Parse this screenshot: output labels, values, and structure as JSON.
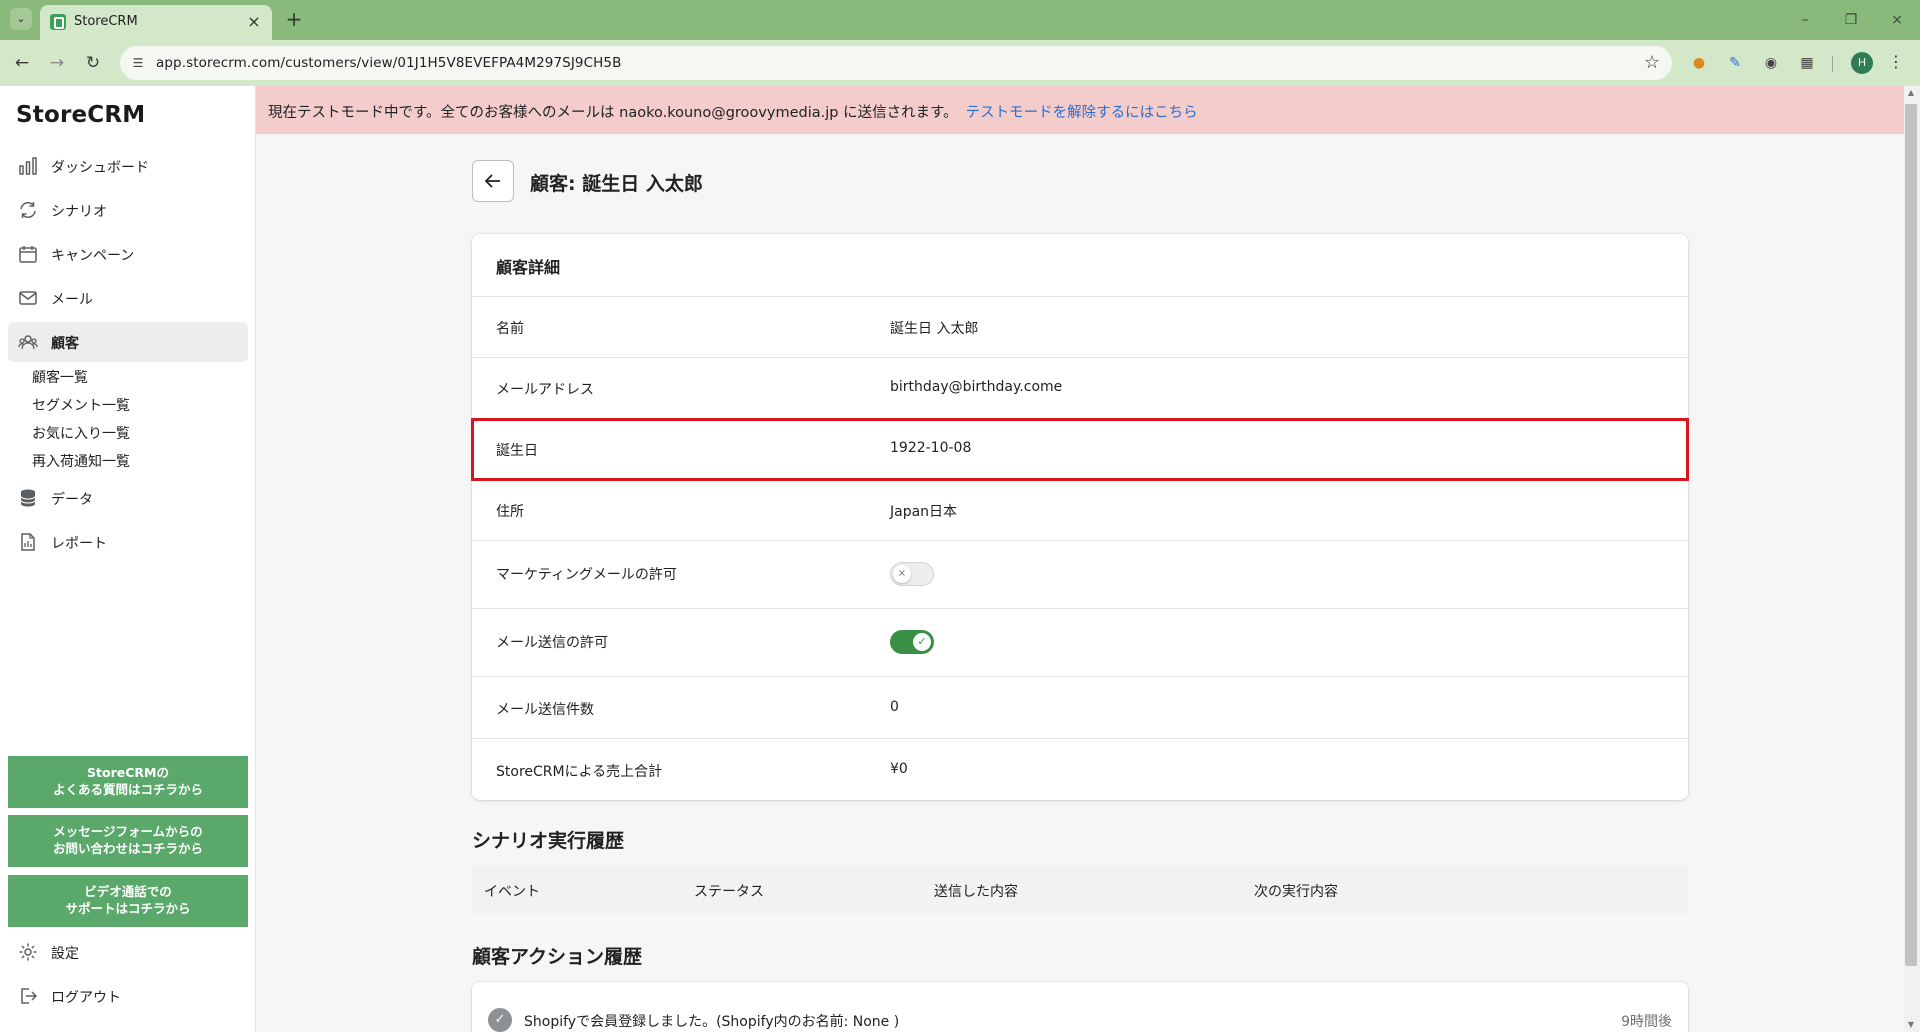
{
  "browser": {
    "tab_title": "StoreCRM",
    "url": "app.storecrm.com/customers/view/01J1H5V8EVEFPA4M297SJ9CH5B",
    "profile_initial": "H"
  },
  "app": {
    "name": "StoreCRM"
  },
  "sidebar": {
    "nav": [
      {
        "label": "ダッシュボード",
        "icon": "bar-chart-icon"
      },
      {
        "label": "シナリオ",
        "icon": "refresh-icon"
      },
      {
        "label": "キャンペーン",
        "icon": "calendar-icon"
      },
      {
        "label": "メール",
        "icon": "envelope-icon"
      },
      {
        "label": "顧客",
        "icon": "users-icon",
        "active": true
      },
      {
        "label": "データ",
        "icon": "database-icon"
      },
      {
        "label": "レポート",
        "icon": "document-icon"
      }
    ],
    "customer_sub": [
      "顧客一覧",
      "セグメント一覧",
      "お気に入り一覧",
      "再入荷通知一覧"
    ],
    "support_buttons": [
      {
        "line1": "StoreCRMの",
        "line2": "よくある質問はコチラから"
      },
      {
        "line1": "メッセージフォームからの",
        "line2": "お問い合わせはコチラから"
      },
      {
        "line1": "ビデオ通話での",
        "line2": "サポートはコチラから"
      }
    ],
    "settings_label": "設定",
    "logout_label": "ログアウト"
  },
  "banner": {
    "text": "現在テストモード中です。全てのお客様へのメールは naoko.kouno@groovymedia.jp に送信されます。",
    "link": "テストモードを解除するにはこちら",
    "bg_color": "#f5cccc"
  },
  "page": {
    "title": "顧客: 誕生日 入太郎"
  },
  "customer_detail": {
    "title": "顧客詳細",
    "rows": [
      {
        "label": "名前",
        "value": "誕生日 入太郎"
      },
      {
        "label": "メールアドレス",
        "value": "birthday@birthday.come"
      },
      {
        "label": "誕生日",
        "value": "1922-10-08"
      },
      {
        "label": "住所",
        "value": "Japan日本"
      },
      {
        "label": "マーケティングメールの許可",
        "toggle": false
      },
      {
        "label": "メール送信の許可",
        "toggle": true
      },
      {
        "label": "メール送信件数",
        "value": "0"
      },
      {
        "label": "StoreCRMによる売上合計",
        "value": "¥0"
      }
    ]
  },
  "scenario_history": {
    "title": "シナリオ実行履歴",
    "columns": [
      "イベント",
      "ステータス",
      "送信した内容",
      "次の実行内容"
    ]
  },
  "action_history": {
    "title": "顧客アクション履歴",
    "items": [
      {
        "text": "Shopifyで会員登録しました。(Shopify内のお名前: None )",
        "time": "9時間後"
      }
    ]
  },
  "colors": {
    "accent_green": "#5aa86a",
    "toggle_on": "#3a8f47",
    "highlight": "#d9161e",
    "link": "#2c6ecb"
  }
}
